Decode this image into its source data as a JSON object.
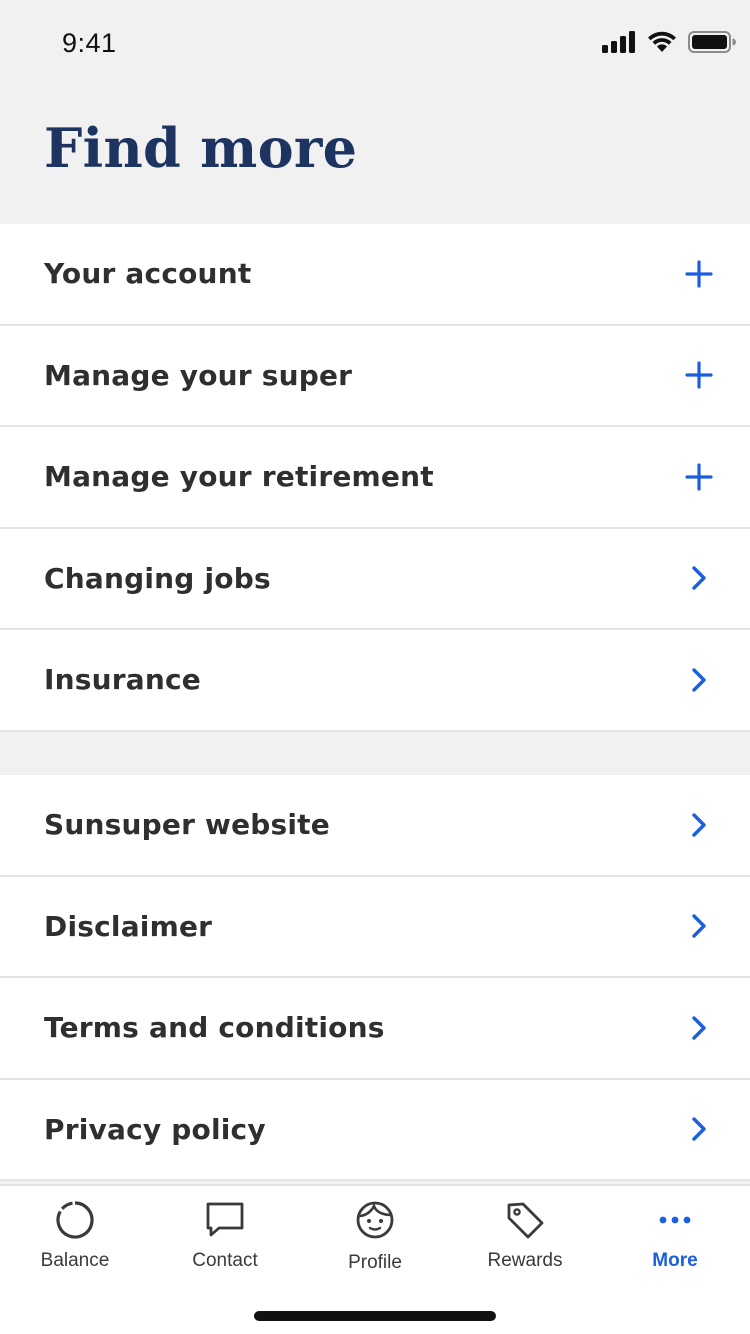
{
  "status_bar": {
    "time": "9:41"
  },
  "header": {
    "title": "Find more"
  },
  "colors": {
    "accent": "#1a5fe0",
    "title": "#1d3461",
    "background": "#f1f1f1"
  },
  "list_primary": [
    {
      "label": "Your account",
      "icon": "plus-icon"
    },
    {
      "label": "Manage your super",
      "icon": "plus-icon"
    },
    {
      "label": "Manage your retirement",
      "icon": "plus-icon"
    },
    {
      "label": "Changing jobs",
      "icon": "chevron-right-icon"
    },
    {
      "label": "Insurance",
      "icon": "chevron-right-icon"
    }
  ],
  "list_secondary": [
    {
      "label": "Sunsuper website",
      "icon": "chevron-right-icon"
    },
    {
      "label": "Disclaimer",
      "icon": "chevron-right-icon"
    },
    {
      "label": "Terms and conditions",
      "icon": "chevron-right-icon"
    },
    {
      "label": "Privacy policy",
      "icon": "chevron-right-icon"
    }
  ],
  "tab_bar": {
    "tabs": [
      {
        "label": "Balance",
        "icon": "balance-ring-icon",
        "active": false
      },
      {
        "label": "Contact",
        "icon": "chat-bubble-icon",
        "active": false
      },
      {
        "label": "Profile",
        "icon": "face-icon",
        "active": false
      },
      {
        "label": "Rewards",
        "icon": "tag-icon",
        "active": false
      },
      {
        "label": "More",
        "icon": "more-dots-icon",
        "active": true
      }
    ]
  }
}
